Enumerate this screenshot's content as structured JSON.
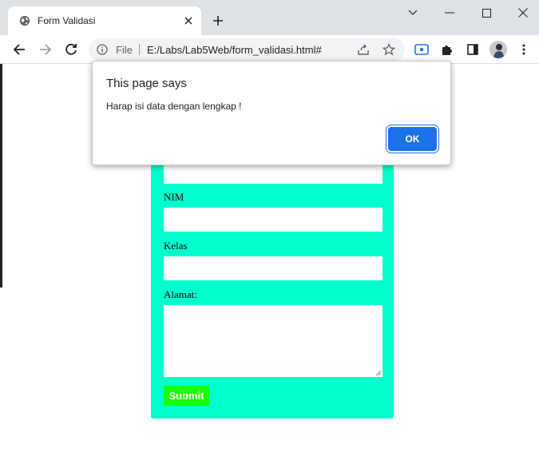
{
  "tab": {
    "title": "Form Validasi"
  },
  "omnibox": {
    "scheme_label": "File",
    "url": "E:/Labs/Lab5Web/form_validasi.html#"
  },
  "form": {
    "nim_label": "NIM",
    "kelas_label": "Kelas",
    "alamat_label": "Alamat:",
    "submit_label": "Submit",
    "background_color": "#00ffcc",
    "submit_color": "#1aff00"
  },
  "alert": {
    "title": "This page says",
    "message": "Harap isi data dengan lengkap !",
    "ok_label": "OK"
  },
  "icons": [
    "globe-icon",
    "close-icon",
    "plus-icon",
    "chevron-down-icon",
    "minimize-icon",
    "maximize-icon",
    "window-close-icon",
    "back-icon",
    "forward-icon",
    "reload-icon",
    "info-icon",
    "share-icon",
    "star-icon",
    "cast-icon",
    "extensions-icon",
    "side-panel-icon",
    "menu-icon"
  ]
}
